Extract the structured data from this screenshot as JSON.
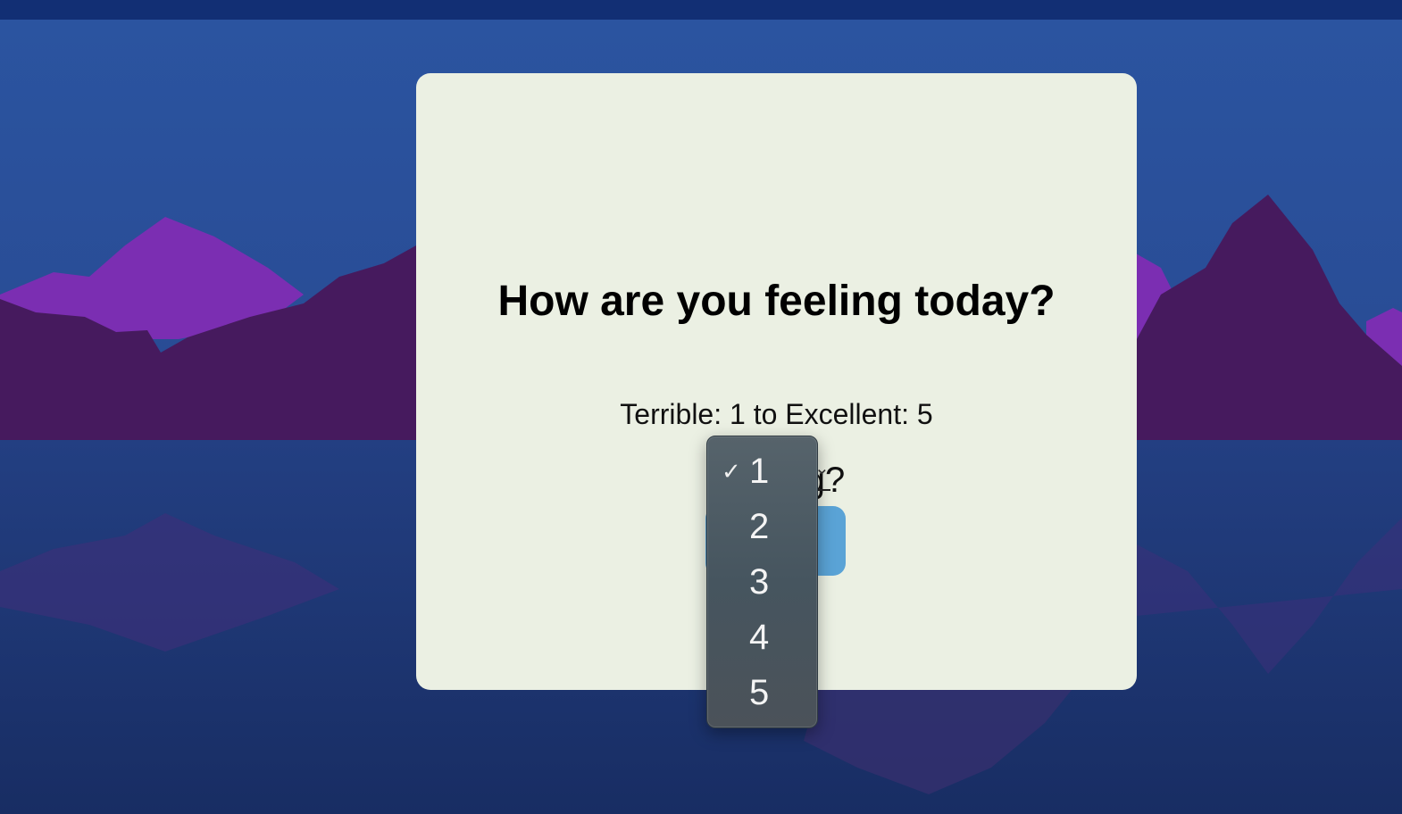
{
  "card": {
    "title": "How are you feeling today?",
    "scale_text": "Terrible: 1 to Excellent: 5",
    "select_label": "Feeling?"
  },
  "dropdown": {
    "selected": "1",
    "options": [
      "1",
      "2",
      "3",
      "4",
      "5"
    ],
    "check_mark": "✓"
  },
  "colors": {
    "card_background": "#ebf0e3",
    "button": "#5aa3d6",
    "sky_top": "#2b54a0",
    "mountains_light": "#7a2fb0",
    "mountains_dark": "#461a5e",
    "water": "#1c3069"
  }
}
